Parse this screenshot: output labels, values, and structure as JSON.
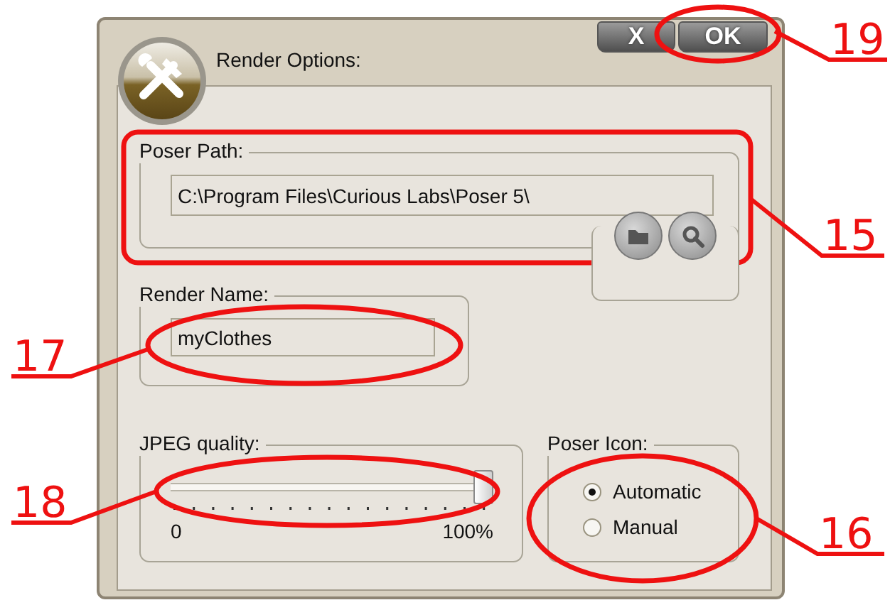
{
  "window": {
    "title": "Render Options:",
    "buttons": [
      {
        "label": "X"
      },
      {
        "label": "OK"
      }
    ]
  },
  "poser_path": {
    "label": "Poser Path:",
    "value": "C:\\Program Files\\Curious Labs\\Poser 5\\"
  },
  "path_buttons": [
    {
      "kind": "folder"
    },
    {
      "kind": "search"
    }
  ],
  "render_name": {
    "label": "Render Name:",
    "value": "myClothes"
  },
  "jpeg_quality": {
    "label": "JPEG quality:",
    "level": 1.0,
    "min_label": "0",
    "max_label": "100%"
  },
  "poser_icon": {
    "label": "Poser Icon:",
    "options": [
      {
        "label": "Automatic",
        "selected": true
      },
      {
        "label": "Manual",
        "selected": false
      }
    ]
  },
  "callouts": [
    {
      "number": "19"
    },
    {
      "number": "15"
    },
    {
      "number": "17"
    },
    {
      "number": "18"
    },
    {
      "number": "16"
    }
  ]
}
